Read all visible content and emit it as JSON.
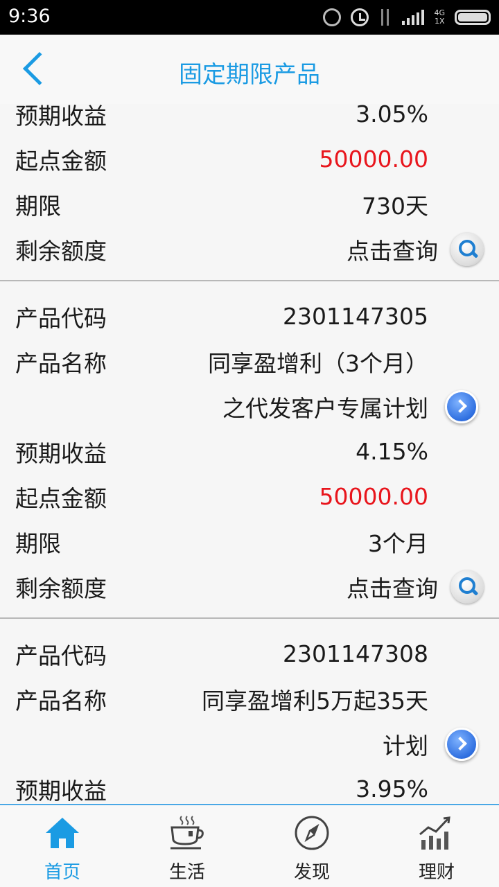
{
  "status_bar": {
    "time": "9:36",
    "net": "4G",
    "net_sub": "1X"
  },
  "nav": {
    "title": "固定期限产品"
  },
  "products": [
    {
      "rows": [
        {
          "label": "预期收益",
          "value": "3.05%"
        },
        {
          "label": "起点金额",
          "value": "50000.00"
        },
        {
          "label": "期限",
          "value": "730天"
        },
        {
          "label": "剩余额度",
          "value": "点击查询"
        }
      ]
    },
    {
      "code_label": "产品代码",
      "code": "2301147305",
      "name_label": "产品名称",
      "name_line1": "同享盈增利（3个月）",
      "name_line2": "之代发客户专属计划",
      "yield_label": "预期收益",
      "yield": "4.15%",
      "min_label": "起点金额",
      "min": "50000.00",
      "term_label": "期限",
      "term": "3个月",
      "quota_label": "剩余额度",
      "quota": "点击查询"
    },
    {
      "code_label": "产品代码",
      "code": "2301147308",
      "name_label": "产品名称",
      "name_line1": "同享盈增利5万起35天",
      "name_line2": "计划",
      "yield_label": "预期收益",
      "yield": "3.95%"
    }
  ],
  "tabs": [
    {
      "label": "首页",
      "icon": "home-icon",
      "active": true
    },
    {
      "label": "生活",
      "icon": "cup-icon",
      "active": false
    },
    {
      "label": "发现",
      "icon": "compass-icon",
      "active": false
    },
    {
      "label": "理财",
      "icon": "chart-icon",
      "active": false
    }
  ],
  "colors": {
    "accent": "#1b9be3",
    "amount_red": "#e8151c"
  }
}
